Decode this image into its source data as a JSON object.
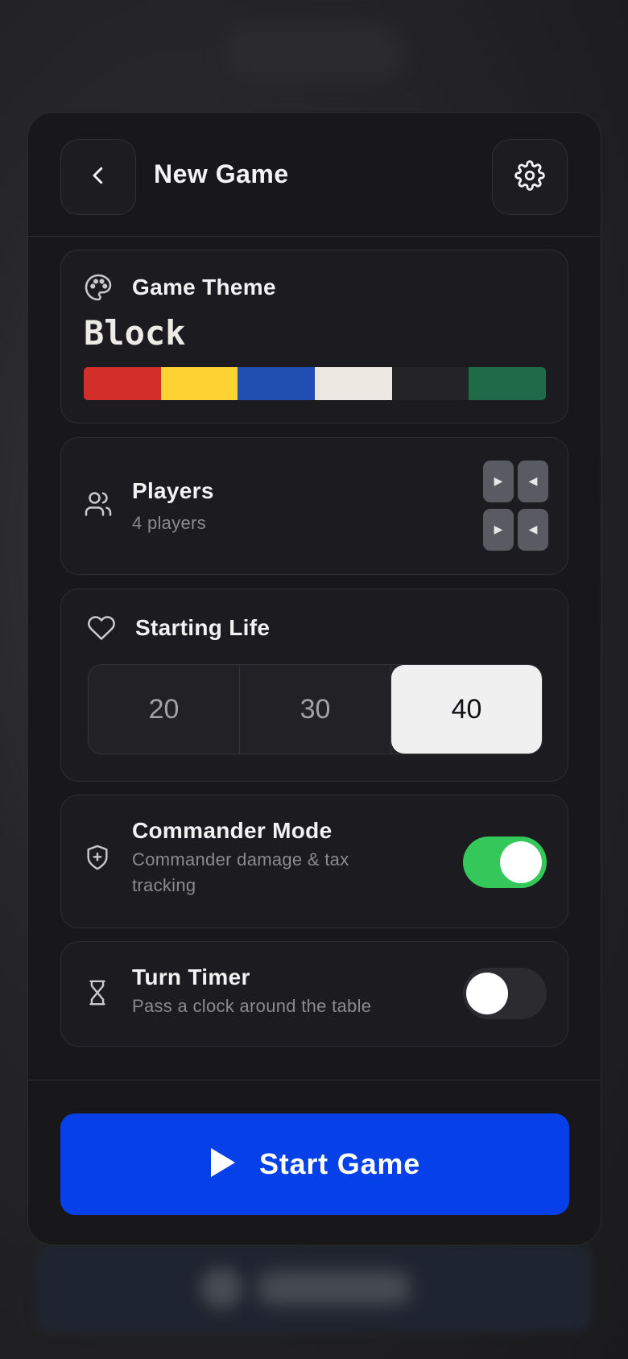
{
  "header": {
    "title": "New Game",
    "back_icon": "chevron-left-icon",
    "settings_icon": "gear-icon"
  },
  "theme": {
    "label": "Game Theme",
    "icon": "palette-icon",
    "name": "Block",
    "colors": [
      "#d32f2a",
      "#fdd334",
      "#1f4fb0",
      "#ece8e1",
      "#242426",
      "#1f6a48"
    ]
  },
  "players": {
    "label": "Players",
    "subtitle": "4 players",
    "icon": "users-icon",
    "count": 4
  },
  "starting_life": {
    "label": "Starting Life",
    "icon": "heart-icon",
    "options": [
      "20",
      "30",
      "40"
    ],
    "selected": "40"
  },
  "commander_mode": {
    "label": "Commander Mode",
    "subtitle_line1": "Commander damage & tax",
    "subtitle_line2": "tracking",
    "icon": "shield-plus-icon",
    "enabled": true,
    "on_color": "#34c759"
  },
  "turn_timer": {
    "label": "Turn Timer",
    "subtitle": "Pass a clock around the table",
    "icon": "hourglass-icon",
    "enabled": false
  },
  "footer": {
    "start_label": "Start Game",
    "start_icon": "play-icon",
    "accent": "#0640e8"
  }
}
